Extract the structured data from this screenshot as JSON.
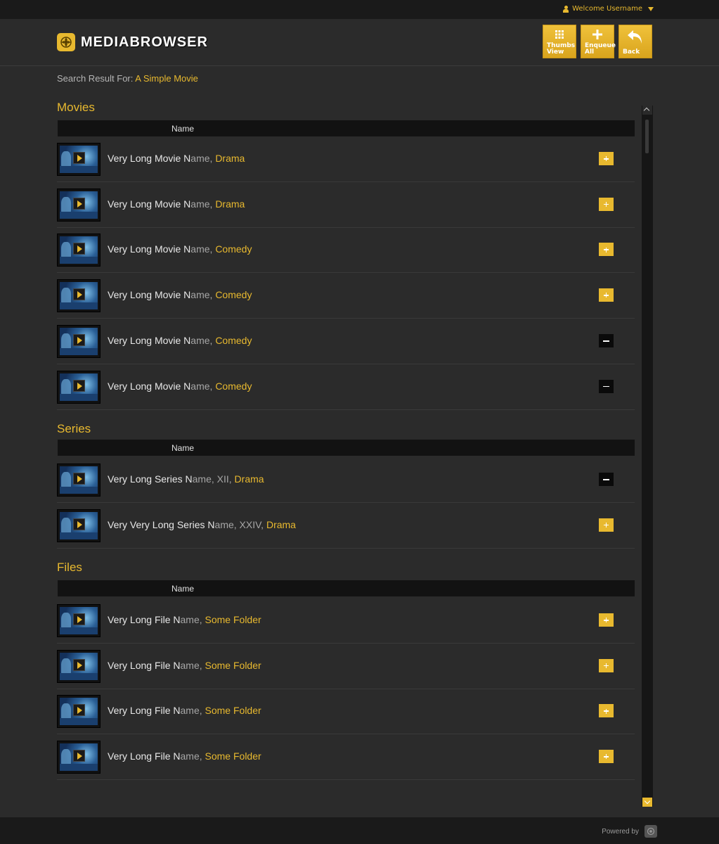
{
  "topbar": {
    "welcome": "Welcome Username"
  },
  "header": {
    "logo_text": "MEDIABROWSER",
    "buttons": [
      {
        "label_line1": "Thumbs",
        "label_line2": "View",
        "icon": "grid-icon"
      },
      {
        "label_line1": "Enqueue",
        "label_line2": "All",
        "icon": "plus-icon"
      },
      {
        "label_line1": "Back",
        "label_line2": "",
        "icon": "back-arrow-icon"
      }
    ]
  },
  "search": {
    "prefix": "Search Result For: ",
    "term": "A Simple Movie"
  },
  "column_header": "Name",
  "sections": {
    "movies": {
      "title": "Movies",
      "rows": [
        {
          "main": "Very Long Movie N",
          "fade": "ame, ",
          "genre": "Drama",
          "action": "add"
        },
        {
          "main": "Very Long Movie N",
          "fade": "ame, ",
          "genre": "Drama",
          "action": "add"
        },
        {
          "main": "Very Long Movie N",
          "fade": "ame, ",
          "genre": "Comedy",
          "action": "add"
        },
        {
          "main": "Very Long Movie N",
          "fade": "ame, ",
          "genre": "Comedy",
          "action": "add"
        },
        {
          "main": "Very Long Movie N",
          "fade": "ame, ",
          "genre": "Comedy",
          "action": "remove"
        },
        {
          "main": "Very Long Movie N",
          "fade": "ame, ",
          "genre": "Comedy",
          "action": "remove"
        }
      ]
    },
    "series": {
      "title": "Series",
      "rows": [
        {
          "main": "Very Long Series N",
          "fade": "ame, XII, ",
          "genre": "Drama",
          "action": "remove"
        },
        {
          "main": "Very Very Long Series N",
          "fade": "ame, XXIV, ",
          "genre": "Drama",
          "action": "add"
        }
      ]
    },
    "files": {
      "title": "Files",
      "rows": [
        {
          "main": "Very Long File N",
          "fade": "ame, ",
          "genre": "Some Folder",
          "action": "add"
        },
        {
          "main": "Very Long File N",
          "fade": "ame, ",
          "genre": "Some Folder",
          "action": "add"
        },
        {
          "main": "Very Long File N",
          "fade": "ame, ",
          "genre": "Some Folder",
          "action": "add"
        },
        {
          "main": "Very Long File N",
          "fade": "ame, ",
          "genre": "Some Folder",
          "action": "add"
        }
      ]
    }
  },
  "footer": {
    "powered_by": "Powered by"
  },
  "colors": {
    "accent": "#e8b92f",
    "background": "#2b2b2b",
    "bar": "#1a1a1a"
  }
}
